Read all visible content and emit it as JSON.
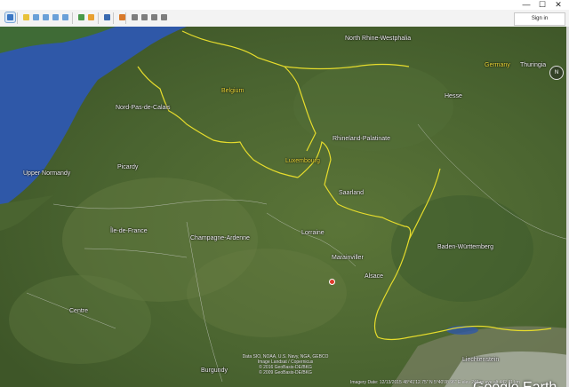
{
  "window": {
    "minimize_glyph": "—",
    "maximize_glyph": "☐",
    "close_glyph": "✕"
  },
  "toolbar": {
    "sign_in_label": "Sign in",
    "tools": [
      {
        "name": "sidebar-toggle-icon",
        "color": "#3a76c4",
        "selected": true
      },
      {
        "name": "placemark-icon",
        "color": "#e8c13a"
      },
      {
        "name": "polygon-icon",
        "color": "#6aa0d8"
      },
      {
        "name": "path-icon",
        "color": "#6aa0d8"
      },
      {
        "name": "image-overlay-icon",
        "color": "#6aa0d8"
      },
      {
        "name": "tour-icon",
        "color": "#6aa0d8"
      },
      {
        "name": "historical-imagery-icon",
        "color": "#4a9a4a"
      },
      {
        "name": "sunlight-icon",
        "color": "#e8a030"
      },
      {
        "name": "planet-icon",
        "color": "#3a6ab0"
      },
      {
        "name": "ruler-icon",
        "color": "#d97a2a"
      },
      {
        "name": "email-icon",
        "color": "#7d7d7d"
      },
      {
        "name": "print-icon",
        "color": "#7d7d7d"
      },
      {
        "name": "save-image-icon",
        "color": "#7d7d7d"
      },
      {
        "name": "google-maps-icon",
        "color": "#7d7d7d"
      }
    ]
  },
  "map": {
    "labels": [
      {
        "id": "north-rhine-westphalia",
        "text": "North Rhine-Westphalia",
        "kind": "region"
      },
      {
        "id": "germany",
        "text": "Germany",
        "kind": "country"
      },
      {
        "id": "thuringia",
        "text": "Thuringia",
        "kind": "region"
      },
      {
        "id": "belgium",
        "text": "Belgium",
        "kind": "country"
      },
      {
        "id": "hesse",
        "text": "Hesse",
        "kind": "region"
      },
      {
        "id": "nord-pas-de-calais",
        "text": "Nord-Pas-de-Calais",
        "kind": "region"
      },
      {
        "id": "rhineland-palatinate",
        "text": "Rhineland-Palatinate",
        "kind": "region"
      },
      {
        "id": "luxembourg",
        "text": "Luxembourg",
        "kind": "country"
      },
      {
        "id": "upper-normandy",
        "text": "Upper Normandy",
        "kind": "region"
      },
      {
        "id": "picardy",
        "text": "Picardy",
        "kind": "region"
      },
      {
        "id": "saarland",
        "text": "Saarland",
        "kind": "region"
      },
      {
        "id": "ile-de-france",
        "text": "Île-de-France",
        "kind": "region"
      },
      {
        "id": "champagne-ardenne",
        "text": "Champagne-Ardenne",
        "kind": "region"
      },
      {
        "id": "lorraine",
        "text": "Lorraine",
        "kind": "region"
      },
      {
        "id": "baden-wurttemberg",
        "text": "Baden-Württemberg",
        "kind": "region"
      },
      {
        "id": "marainviller",
        "text": "Marainviller",
        "kind": "place"
      },
      {
        "id": "alsace",
        "text": "Alsace",
        "kind": "region"
      },
      {
        "id": "centre",
        "text": "Centre",
        "kind": "region"
      },
      {
        "id": "burgundy",
        "text": "Burgundy",
        "kind": "region"
      },
      {
        "id": "liechtenstein",
        "text": "Liechtenstein",
        "kind": "region"
      }
    ],
    "watermark": "Google Earth",
    "credits": "Data SIO, NOAA, U.S. Navy, NGA, GEBCO\nImage Landsat / Copernicus\n© 2016 GeoBasis-DE/BKG\n© 2009 GeoBasis-DE/BKG",
    "status": "Imagery Date: 12/13/2015    48°41'12.75\" N    5°40'08.96\" E    elev  246 m    eye alt  442.71 km",
    "compass_label": "N",
    "colors": {
      "sea": "#2f58a8",
      "land": "#4f6a33",
      "border": "#e6dc2c",
      "toolbar": "#f3f3f3"
    }
  }
}
